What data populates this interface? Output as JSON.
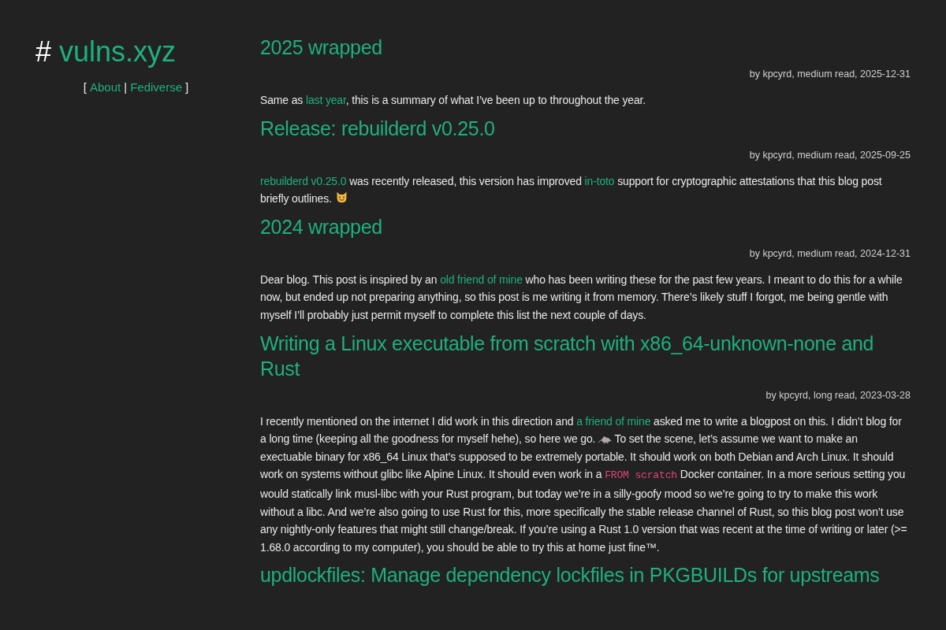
{
  "site": {
    "hash": "#",
    "title": "vulns.xyz",
    "nav": [
      {
        "label": "About"
      },
      {
        "label": "Fediverse"
      }
    ],
    "open": "[",
    "sep": "|",
    "close": "]"
  },
  "posts": [
    {
      "title": "2025 wrapped",
      "meta": "by kpcyrd, medium read, 2025-12-31",
      "summary": [
        {
          "kind": "text",
          "text": "Same as "
        },
        {
          "kind": "link",
          "text": "last year"
        },
        {
          "kind": "text",
          "text": ", this is a summary of what I’ve been up to throughout the year."
        }
      ]
    },
    {
      "title": "Release: rebuilderd v0.25.0",
      "meta": "by kpcyrd, medium read, 2025-09-25",
      "summary": [
        {
          "kind": "link",
          "text": "rebuilderd v0.25.0"
        },
        {
          "kind": "text",
          "text": " was recently released, this version has improved "
        },
        {
          "kind": "link",
          "text": "in-toto"
        },
        {
          "kind": "text",
          "text": " support for cryptographic attestations that this blog post briefly outlines. "
        },
        {
          "kind": "cat"
        }
      ]
    },
    {
      "title": "2024 wrapped",
      "meta": "by kpcyrd, medium read, 2024-12-31",
      "summary": [
        {
          "kind": "text",
          "text": "Dear blog. This post is inspired by an "
        },
        {
          "kind": "link",
          "text": "old friend of mine"
        },
        {
          "kind": "text",
          "text": " who has been writing these for the past few years. I meant to do this for a while now, but ended up not preparing anything, so this post is me writing it from memory. There’s likely stuff I forgot, me being gentle with myself I’ll probably just permit myself to complete this list the next couple of days."
        }
      ]
    },
    {
      "title": "Writing a Linux executable from scratch with x86_64-unknown-none and Rust",
      "meta": "by kpcyrd, long read, 2023-03-28",
      "summary": [
        {
          "kind": "text",
          "text": "I recently mentioned on the internet I did work in this direction and "
        },
        {
          "kind": "link",
          "text": "a friend of mine"
        },
        {
          "kind": "text",
          "text": " asked me to write a blogpost on this. I didn’t blog for a long time (keeping all the goodness for myself hehe), so here we go. "
        },
        {
          "kind": "rat"
        },
        {
          "kind": "text",
          "text": " To set the scene, let’s assume we want to make an exectuable binary for x86_64 Linux that’s supposed to be extremely portable. It should work on both Debian and Arch Linux. It should work on systems without glibc like Alpine Linux. It should even work in a "
        },
        {
          "kind": "code",
          "text": "FROM scratch"
        },
        {
          "kind": "text",
          "text": " Docker container. In a more serious setting you would statically link musl-libc with your Rust program, but today we’re in a silly-goofy mood so we’re going to try to make this work without a libc. And we’re also going to use Rust for this, more specifically the stable release channel of Rust, so this blog post won’t use any nightly-only features that might still change/break. If you’re using a Rust 1.0 version that was recent at the time of writing or later (>= 1.68.0 according to my computer), you should be able to try this at home just fine™."
        }
      ]
    },
    {
      "title": "updlockfiles: Manage dependency lockfiles in PKGBUILDs for upstreams"
    }
  ]
}
